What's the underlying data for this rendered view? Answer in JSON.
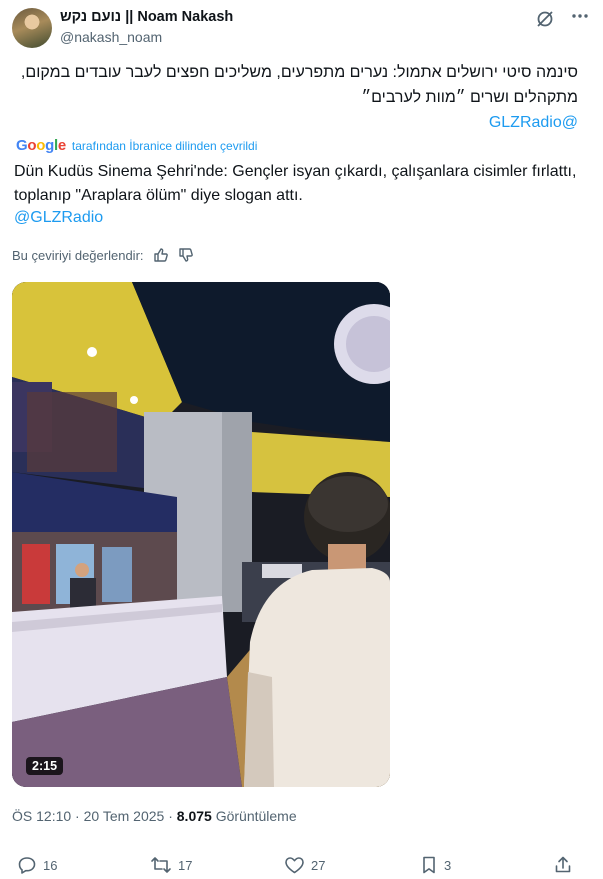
{
  "author": {
    "display_name": "נועם נקש || Noam Nakash",
    "handle": "@nakash_noam"
  },
  "tweet": {
    "hebrew_text": "סינמה סיטי ירושלים אתמול: נערים מתפרעים, משליכים חפצים לעבר עובדים במקום, מתקהלים ושרים ״מוות לערבים״",
    "hebrew_mention": "@GLZRadio",
    "translation_brand": "Google",
    "translation_notice": "tarafından İbranice dilinden çevrildi",
    "translated_text": "Dün Kudüs Sinema Şehri'nde: Gençler isyan çıkardı, çalışanlara cisimler fırlattı, toplanıp \"Araplara ölüm\" diye slogan attı.",
    "translated_mention": "@GLZRadio",
    "rate_label": "Bu çeviriyi değerlendir:"
  },
  "video": {
    "duration": "2:15"
  },
  "meta": {
    "time": "ÖS 12:10",
    "separator": "·",
    "date": "20 Tem 2025",
    "views_count": "8.075",
    "views_label": "Görüntüleme"
  },
  "actions": {
    "replies": "16",
    "reposts": "17",
    "likes": "27",
    "bookmarks": "3"
  },
  "icons": [
    "grok-icon",
    "more-icon",
    "thumbs-up-icon",
    "thumbs-down-icon",
    "reply-icon",
    "repost-icon",
    "like-icon",
    "bookmark-icon",
    "share-icon"
  ],
  "colors": {
    "link": "#1d9bf0",
    "muted": "#536471",
    "text": "#0f1419"
  }
}
